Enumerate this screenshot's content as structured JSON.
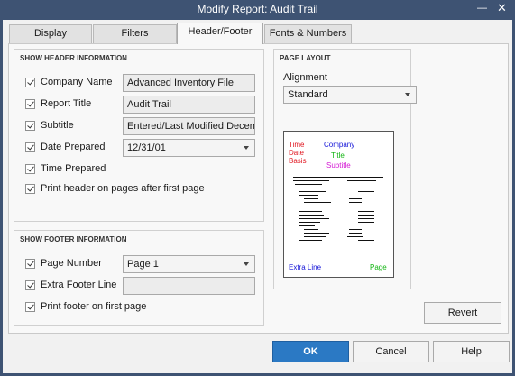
{
  "window": {
    "title": "Modify Report: Audit Trail",
    "min_label": "—",
    "close_label": "✕"
  },
  "tabs": [
    {
      "label": "Display",
      "active": false
    },
    {
      "label": "Filters",
      "active": false
    },
    {
      "label": "Header/Footer",
      "active": true
    },
    {
      "label": "Fonts & Numbers",
      "active": false
    }
  ],
  "header_section": {
    "title": "SHOW HEADER INFORMATION",
    "company_name": {
      "label": "Company Name",
      "checked": true,
      "value": "Advanced Inventory File"
    },
    "report_title": {
      "label": "Report Title",
      "checked": true,
      "value": "Audit Trail"
    },
    "subtitle": {
      "label": "Subtitle",
      "checked": true,
      "value": "Entered/Last Modified Decem..."
    },
    "date_prepared": {
      "label": "Date Prepared",
      "checked": true,
      "value": "12/31/01"
    },
    "time_prepared": {
      "label": "Time Prepared",
      "checked": true
    },
    "print_header": {
      "label": "Print header on pages after first page",
      "checked": true
    }
  },
  "footer_section": {
    "title": "SHOW FOOTER INFORMATION",
    "page_number": {
      "label": "Page Number",
      "checked": true,
      "value": "Page 1"
    },
    "extra_footer": {
      "label": "Extra Footer Line",
      "checked": true,
      "value": ""
    },
    "print_footer": {
      "label": "Print footer on first page",
      "checked": true
    }
  },
  "page_layout": {
    "title": "PAGE LAYOUT",
    "alignment_label": "Alignment",
    "alignment_value": "Standard",
    "preview": {
      "time": "Time",
      "date": "Date",
      "basis": "Basis",
      "company": "Company",
      "title": "Title",
      "subtitle": "Subtitle",
      "extra_line": "Extra Line",
      "page": "Page"
    }
  },
  "buttons": {
    "revert": "Revert",
    "ok": "OK",
    "cancel": "Cancel",
    "help": "Help"
  },
  "colors": {
    "accent": "#2b79c4",
    "time_red": "#e0141e",
    "company_blue": "#1414d8",
    "title_green": "#11b411",
    "subtitle_magenta": "#d419d4"
  }
}
